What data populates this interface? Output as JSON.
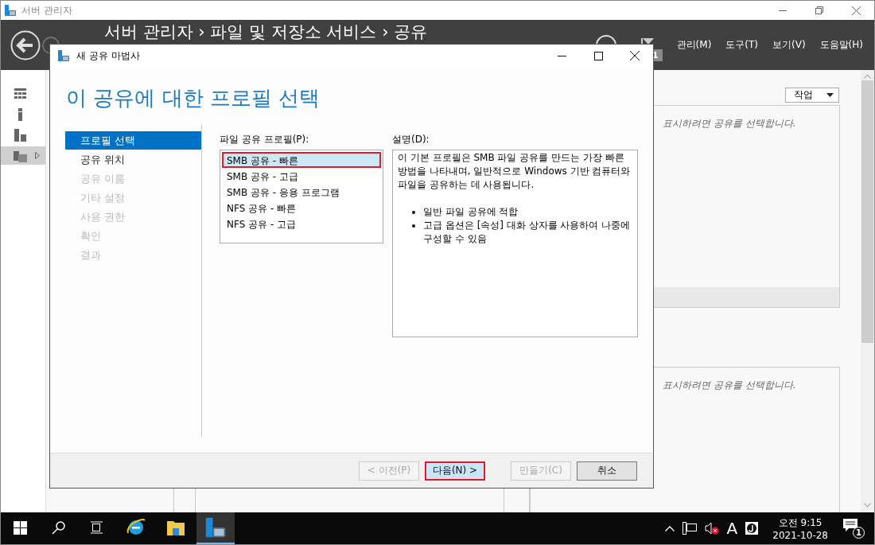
{
  "app_window": {
    "title": "서버 관리자"
  },
  "header": {
    "breadcrumb": "서버 관리자 › 파일 및 저장소 서비스 › 공유",
    "notification_count": "1",
    "menu": [
      "관리(M)",
      "도구(T)",
      "보기(V)",
      "도움말(H)"
    ]
  },
  "side_nav": [
    {
      "selected": false
    },
    {
      "selected": false
    },
    {
      "selected": false
    },
    {
      "selected": true
    }
  ],
  "background": {
    "tasks_button": "작업",
    "panels": [
      {
        "message": "표시하려면 공유를 선택합니다."
      },
      {
        "message": "표시하려면 공유를 선택합니다."
      }
    ]
  },
  "dialog": {
    "title": "새 공유 마법사",
    "heading": "이 공유에 대한 프로필 선택",
    "steps": [
      {
        "label": "프로필 선택",
        "selected": true,
        "disabled": false
      },
      {
        "label": "공유 위치",
        "selected": false,
        "disabled": false
      },
      {
        "label": "공유 이름",
        "selected": false,
        "disabled": true
      },
      {
        "label": "기타 설정",
        "selected": false,
        "disabled": true
      },
      {
        "label": "사용 권한",
        "selected": false,
        "disabled": true
      },
      {
        "label": "확인",
        "selected": false,
        "disabled": true
      },
      {
        "label": "결과",
        "selected": false,
        "disabled": true
      }
    ],
    "profile_list": {
      "label": "파일 공유 프로필(P):",
      "items": [
        {
          "label": "SMB 공유 - 빠른",
          "selected": true,
          "annotated": true
        },
        {
          "label": "SMB 공유 - 고급",
          "selected": false,
          "annotated": false
        },
        {
          "label": "SMB 공유 - 응용 프로그램",
          "selected": false,
          "annotated": false
        },
        {
          "label": "NFS 공유 - 빠른",
          "selected": false,
          "annotated": false
        },
        {
          "label": "NFS 공유 - 고급",
          "selected": false,
          "annotated": false
        }
      ]
    },
    "description": {
      "label": "설명(D):",
      "text": "이 기본 프로필은 SMB 파일 공유를 만드는 가장 빠른 방법을 나타내며, 일반적으로 Windows 기반 컴퓨터와 파일을 공유하는 데 사용됩니다.",
      "bullets": [
        "일반 파일 공유에 적합",
        "고급 옵션은 [속성] 대화 상자를 사용하여 나중에 구성할 수 있음"
      ]
    },
    "buttons": [
      {
        "label": "< 이전(P)",
        "disabled": true,
        "default": false,
        "annotated": false
      },
      {
        "label": "다음(N) >",
        "disabled": false,
        "default": true,
        "annotated": true
      },
      {
        "label": "만들기(C)",
        "disabled": true,
        "default": false,
        "annotated": false
      },
      {
        "label": "취소",
        "disabled": false,
        "default": false,
        "annotated": false
      }
    ]
  },
  "taskbar": {
    "apps": [
      {
        "kind": "browser",
        "selected": false
      },
      {
        "kind": "folder",
        "selected": false
      },
      {
        "kind": "server",
        "selected": true
      }
    ],
    "ime": "A",
    "clock": {
      "time": "오전 9:15",
      "date": "2021-10-28"
    },
    "notification_count": "1"
  }
}
